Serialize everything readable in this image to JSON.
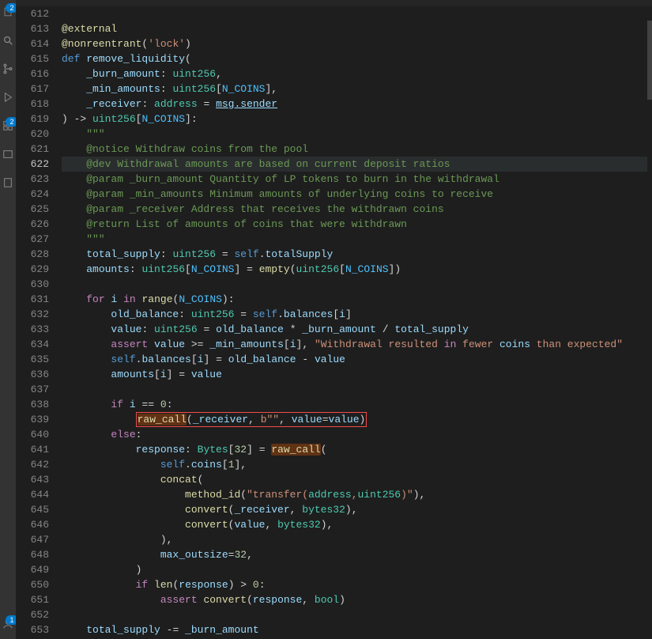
{
  "activity_bar": {
    "badges": {
      "top": "2",
      "bottom": "1"
    }
  },
  "line_start": 612,
  "lines": [
    "",
    "@external",
    "@nonreentrant('lock')",
    "def remove_liquidity(",
    "    _burn_amount: uint256,",
    "    _min_amounts: uint256[N_COINS],",
    "    _receiver: address = msg.sender",
    ") -> uint256[N_COINS]:",
    "    \"\"\"",
    "    @notice Withdraw coins from the pool",
    "    @dev Withdrawal amounts are based on current deposit ratios",
    "    @param _burn_amount Quantity of LP tokens to burn in the withdrawal",
    "    @param _min_amounts Minimum amounts of underlying coins to receive",
    "    @param _receiver Address that receives the withdrawn coins",
    "    @return List of amounts of coins that were withdrawn",
    "    \"\"\"",
    "    total_supply: uint256 = self.totalSupply",
    "    amounts: uint256[N_COINS] = empty(uint256[N_COINS])",
    "",
    "    for i in range(N_COINS):",
    "        old_balance: uint256 = self.balances[i]",
    "        value: uint256 = old_balance * _burn_amount / total_supply",
    "        assert value >= _min_amounts[i], \"Withdrawal resulted in fewer coins than expected\"",
    "        self.balances[i] = old_balance - value",
    "        amounts[i] = value",
    "",
    "        if i == 0:",
    "            raw_call(_receiver, b\"\", value=value)",
    "        else:",
    "            response: Bytes[32] = raw_call(",
    "                self.coins[1],",
    "                concat(",
    "                    method_id(\"transfer(address,uint256)\"),",
    "                    convert(_receiver, bytes32),",
    "                    convert(value, bytes32),",
    "                ),",
    "                max_outsize=32,",
    "            )",
    "            if len(response) > 0:",
    "                assert convert(response, bool)",
    "",
    "    total_supply -= _burn_amount"
  ],
  "active_line": 622
}
